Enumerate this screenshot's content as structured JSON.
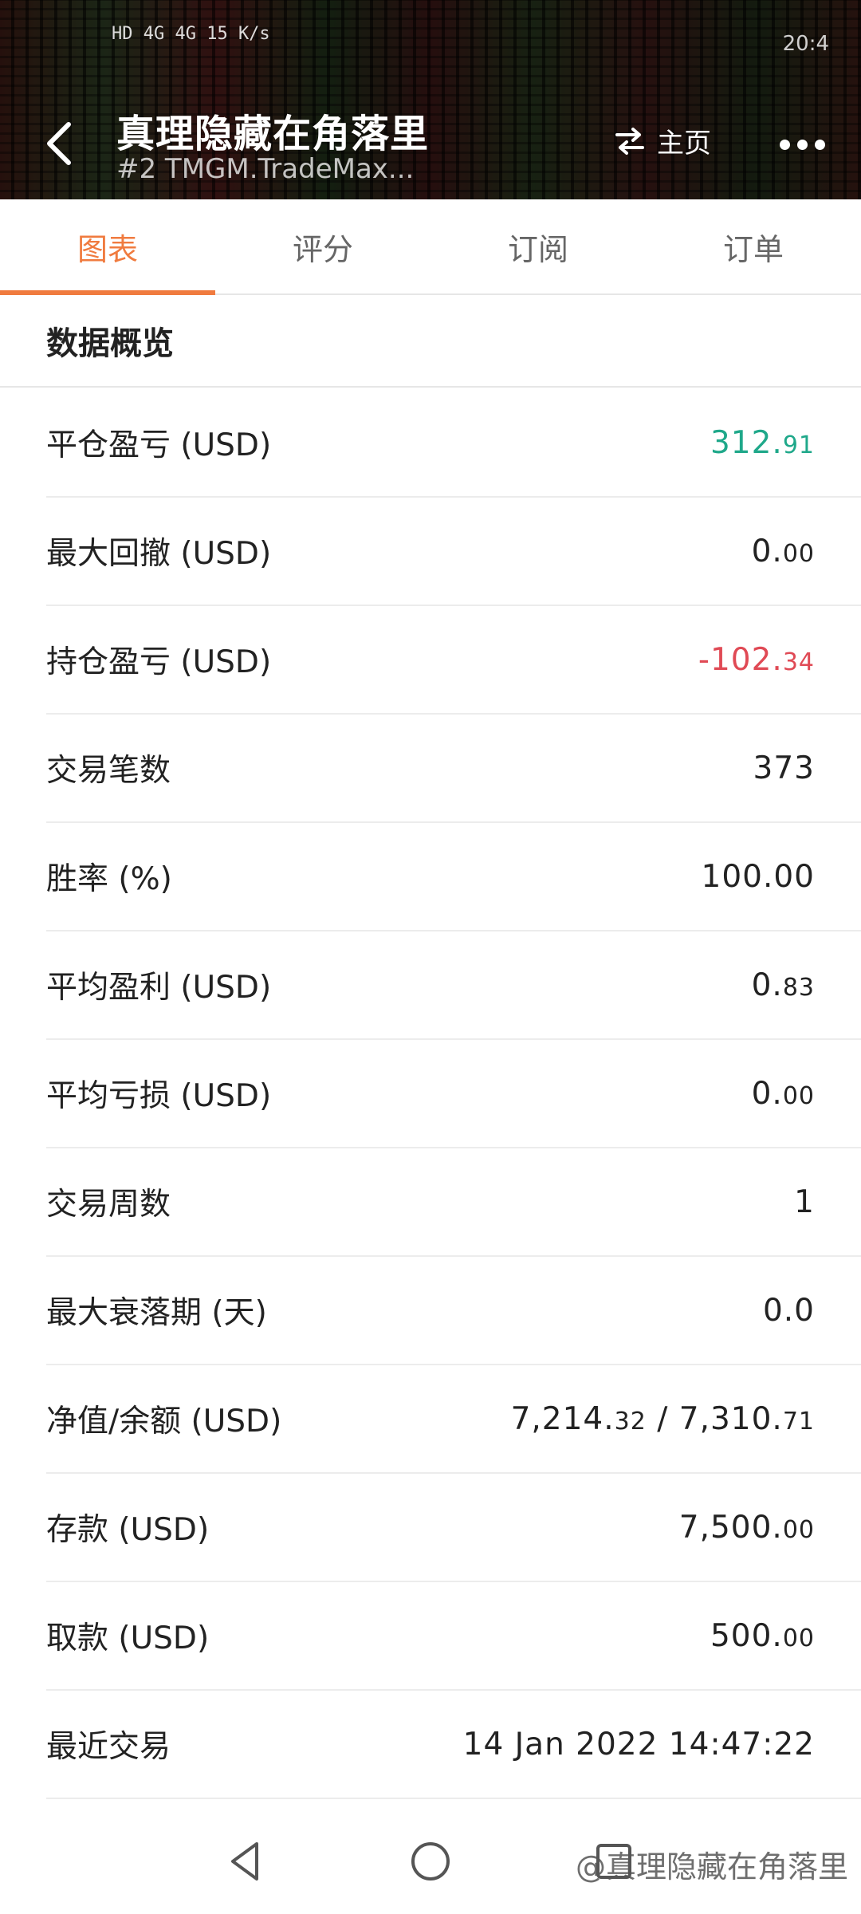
{
  "status_bar": {
    "left_text": "HD 4G 4G 15 K/s",
    "right_text": "20:4"
  },
  "header": {
    "title": "真理隐藏在角落里",
    "subtitle": "#2  TMGM.TradeMax...",
    "home_label": "主页"
  },
  "tabs": [
    {
      "label": "图表",
      "active": true
    },
    {
      "label": "评分",
      "active": false
    },
    {
      "label": "订阅",
      "active": false
    },
    {
      "label": "订单",
      "active": false
    }
  ],
  "section_title": "数据概览",
  "rows": [
    {
      "label": "平仓盈亏 (USD)",
      "int": "312.",
      "dec": "91",
      "color": "green"
    },
    {
      "label": "最大回撤 (USD)",
      "int": "0.",
      "dec": "00",
      "color": ""
    },
    {
      "label": "持仓盈亏 (USD)",
      "int": "-102.",
      "dec": "34",
      "color": "red"
    },
    {
      "label": "交易笔数",
      "value": "373"
    },
    {
      "label": "胜率 (%)",
      "value": "100.00"
    },
    {
      "label": "平均盈利 (USD)",
      "int": "0.",
      "dec": "83"
    },
    {
      "label": "平均亏损 (USD)",
      "int": "0.",
      "dec": "00"
    },
    {
      "label": "交易周数",
      "value": "1"
    },
    {
      "label": "最大衰落期 (天)",
      "value": "0.0"
    },
    {
      "label": "净值/余额 (USD)",
      "int": "7,214.",
      "dec": "32",
      "int2": " / 7,310.",
      "dec2": "71"
    },
    {
      "label": "存款 (USD)",
      "int": "7,500.",
      "dec": "00"
    },
    {
      "label": "取款 (USD)",
      "int": "500.",
      "dec": "00"
    },
    {
      "label": "最近交易",
      "value": "14 Jan 2022 14:47:22"
    }
  ],
  "watermark": "@真理隐藏在角落里",
  "colors": {
    "accent": "#f07b3f",
    "positive": "#1fa88a",
    "negative": "#e04a55"
  }
}
